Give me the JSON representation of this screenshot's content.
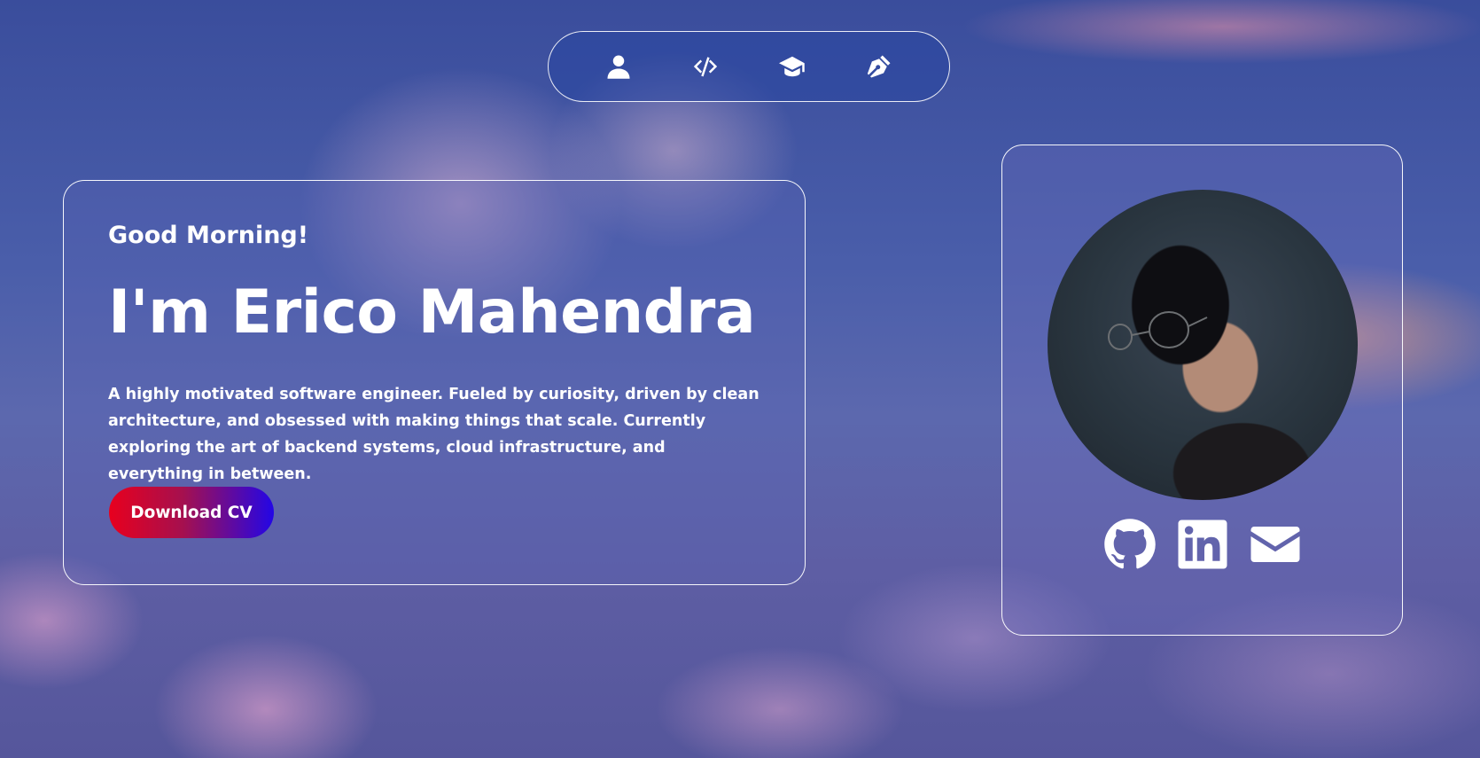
{
  "nav": {
    "items": [
      {
        "icon": "user-icon"
      },
      {
        "icon": "code-icon"
      },
      {
        "icon": "graduation-cap-icon"
      },
      {
        "icon": "pen-nib-icon"
      }
    ]
  },
  "hero": {
    "greeting": "Good Morning!",
    "name": "I'm Erico Mahendra",
    "bio": "A highly motivated software engineer. Fueled by curiosity, driven by clean architecture, and obsessed with making things that scale. Currently exploring the art of backend systems, cloud infrastructure, and everything in between.",
    "cv_button": "Download CV"
  },
  "profile": {
    "photo": "profile-photo",
    "socials": [
      {
        "icon": "github-icon"
      },
      {
        "icon": "linkedin-icon"
      },
      {
        "icon": "email-icon"
      }
    ]
  },
  "colors": {
    "button_gradient_start": "#e8001e",
    "button_gradient_end": "#2306e6",
    "card_border": "#ffffff"
  }
}
